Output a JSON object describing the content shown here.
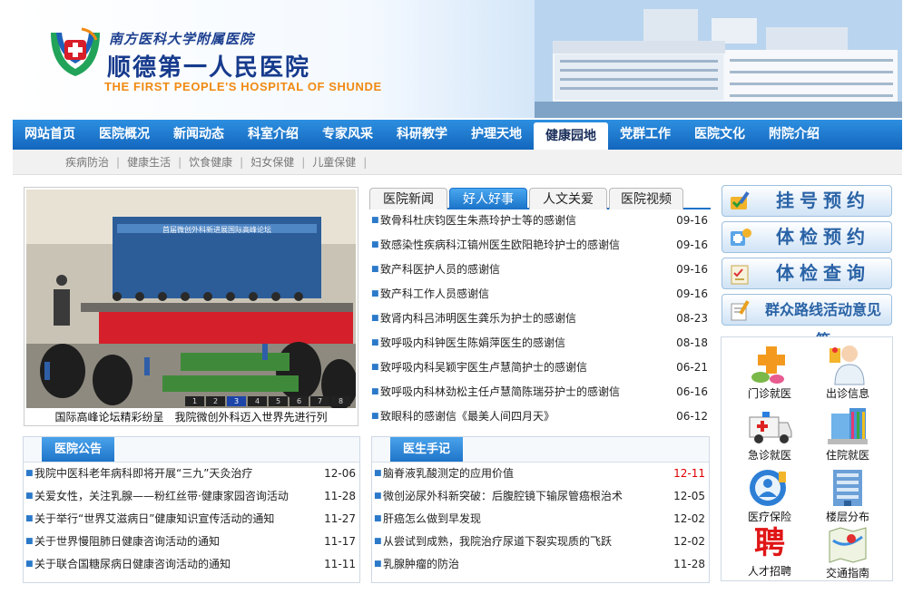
{
  "header": {
    "subtitle": "南方医科大学附属医院",
    "name": "顺德第一人民医院",
    "english": "THE FIRST PEOPLE'S HOSPITAL OF SHUNDE",
    "building_sign": "顺德第一人民医院"
  },
  "nav": {
    "items": [
      "网站首页",
      "医院概况",
      "新闻动态",
      "科室介绍",
      "专家风采",
      "科研教学",
      "护理天地",
      "健康园地",
      "党群工作",
      "医院文化",
      "附院介绍"
    ],
    "active": "健康园地"
  },
  "subnav": [
    "疾病防治",
    "健康生活",
    "饮食健康",
    "妇女保健",
    "儿童保健"
  ],
  "slideshow": {
    "caption": "国际高峰论坛精彩纷呈　我院微创外科迈入世界先进行列",
    "pages": [
      "1",
      "2",
      "3",
      "4",
      "5",
      "6",
      "7",
      "8"
    ],
    "current_page": "3",
    "banner_text": "首届微创外科新进展国际高峰论坛"
  },
  "news_tabs": {
    "tabs": [
      "医院新闻",
      "好人好事",
      "人文关爱",
      "医院视频"
    ],
    "active": "好人好事",
    "items": [
      {
        "title": "致骨科杜庆钧医生朱燕玲护士等的感谢信",
        "date": "09-16"
      },
      {
        "title": "致感染性疾病科江镐州医生欧阳艳玲护士的感谢信",
        "date": "09-16"
      },
      {
        "title": "致产科医护人员的感谢信",
        "date": "09-16"
      },
      {
        "title": "致产科工作人员感谢信",
        "date": "09-16"
      },
      {
        "title": "致肾内科吕沛明医生龚乐为护士的感谢信",
        "date": "08-23"
      },
      {
        "title": "致呼吸内科钟医生陈娟萍医生的感谢信",
        "date": "08-18"
      },
      {
        "title": "致呼吸内科吴颖宇医生卢慧简护士的感谢信",
        "date": "06-21"
      },
      {
        "title": "致呼吸内科林劲松主任卢慧简陈瑞芬护士的感谢信",
        "date": "06-16"
      },
      {
        "title": "致眼科的感谢信《最美人间四月天》",
        "date": "06-12"
      }
    ]
  },
  "announcements": {
    "title": "医院公告",
    "items": [
      {
        "title": "我院中医科老年病科即将开展“三九”天灸治疗",
        "date": "12-06"
      },
      {
        "title": "关爱女性，关注乳腺——粉红丝带·健康家园咨询活动",
        "date": "11-28"
      },
      {
        "title": "关于举行“世界艾滋病日”健康知识宣传活动的通知",
        "date": "11-27"
      },
      {
        "title": "关于世界慢阻肺日健康咨询活动的通知",
        "date": "11-17"
      },
      {
        "title": "关于联合国糖尿病日健康咨询活动的通知",
        "date": "11-11"
      }
    ]
  },
  "doctor_notes": {
    "title": "医生手记",
    "items": [
      {
        "title": "脑脊液乳酸测定的应用价值",
        "date": "12-11",
        "highlight": true
      },
      {
        "title": "微创泌尿外科新突破：后腹腔镜下输尿管癌根治术",
        "date": "12-05"
      },
      {
        "title": "肝癌怎么做到早发现",
        "date": "12-02"
      },
      {
        "title": "从尝试到成熟，我院治疗尿道下裂实现质的飞跃",
        "date": "12-02"
      },
      {
        "title": "乳腺肿瘤的防治",
        "date": "11-28"
      }
    ]
  },
  "quick_buttons": [
    "挂号预约",
    "体检预约",
    "体检查询",
    "群众路线活动意见箱"
  ],
  "services": [
    {
      "label": "门诊就医",
      "icon": "outpatient-icon"
    },
    {
      "label": "出诊信息",
      "icon": "doctor-schedule-icon"
    },
    {
      "label": "急诊就医",
      "icon": "ambulance-icon"
    },
    {
      "label": "住院就医",
      "icon": "hospital-building-icon"
    },
    {
      "label": "医疗保险",
      "icon": "insurance-icon"
    },
    {
      "label": "楼层分布",
      "icon": "floor-plan-icon"
    },
    {
      "label": "人才招聘",
      "icon": "recruit-icon",
      "glyph": "聘"
    },
    {
      "label": "交通指南",
      "icon": "map-icon"
    }
  ],
  "colors": {
    "nav_blue": "#1e73c9",
    "accent_orange": "#f08a12",
    "title_navy": "#163a8c",
    "date_highlight": "#e00000"
  }
}
